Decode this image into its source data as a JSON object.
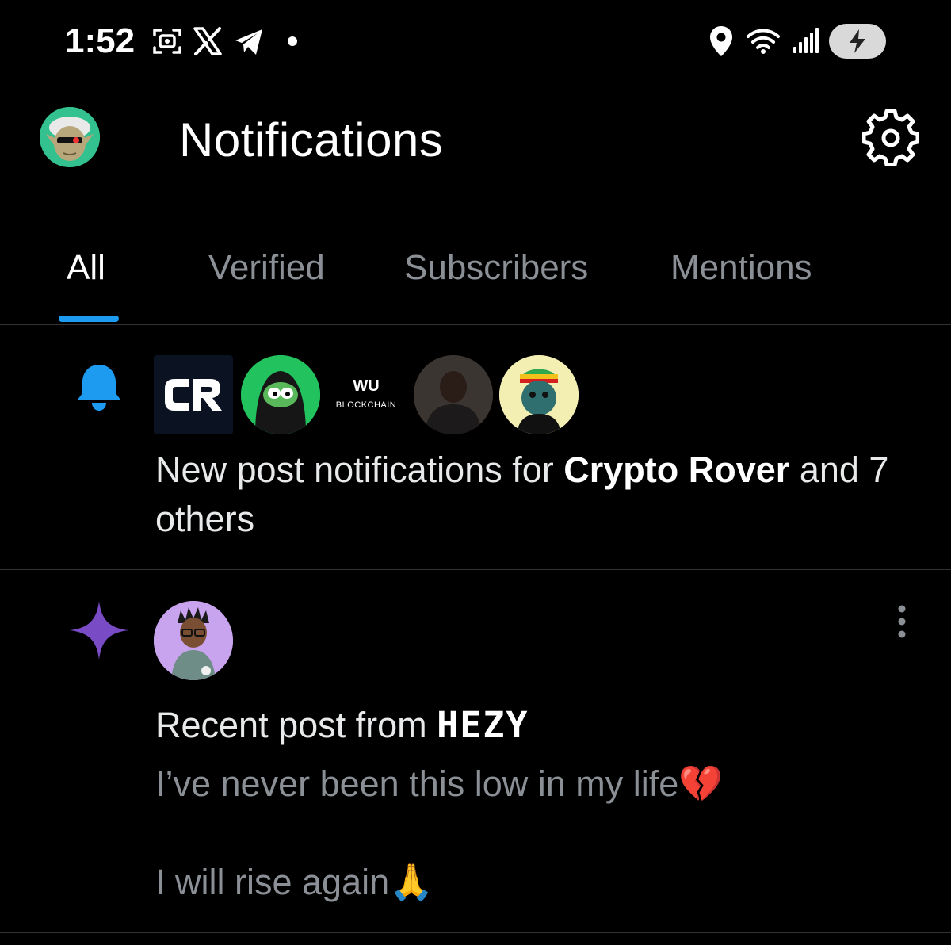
{
  "status_bar": {
    "time": "1:52",
    "left_icons": [
      "screenshot-icon",
      "x-logo-icon",
      "telegram-icon",
      "dot-icon"
    ],
    "right_icons": [
      "location-icon",
      "wifi-icon",
      "signal-icon",
      "battery-charging-icon"
    ]
  },
  "header": {
    "title": "Notifications",
    "avatar": "profile-avatar",
    "settings_icon": "gear-icon"
  },
  "tabs": [
    {
      "label": "All",
      "active": true
    },
    {
      "label": "Verified",
      "active": false
    },
    {
      "label": "Subscribers",
      "active": false
    },
    {
      "label": "Mentions",
      "active": false
    }
  ],
  "notifications": [
    {
      "type": "bell",
      "icon": "bell-icon",
      "accent": "#1d9bf0",
      "avatars": [
        {
          "name": "cr-logo-avatar",
          "text": "CR"
        },
        {
          "name": "green-frog-avatar"
        },
        {
          "name": "wu-blockchain-avatar",
          "line1": "WU",
          "line2": "BLOCKCHAIN"
        },
        {
          "name": "person-avatar"
        },
        {
          "name": "rasta-ape-avatar"
        }
      ],
      "text_prefix": "New post notifications for ",
      "text_bold": "Crypto Rover",
      "text_suffix": " and 7 others"
    },
    {
      "type": "recent",
      "icon": "sparkle-icon",
      "accent": "#794bc4",
      "avatar": "hezy-avatar",
      "text_prefix": "Recent post from ",
      "author": "HEZY",
      "lines": [
        "I’ve never been this low in my life💔",
        "I will rise again🙏"
      ]
    }
  ],
  "colors": {
    "background": "#000000",
    "text": "#e7e9ea",
    "muted": "#8b9096",
    "accent_blue": "#1d9bf0",
    "divider": "#2f3336"
  }
}
